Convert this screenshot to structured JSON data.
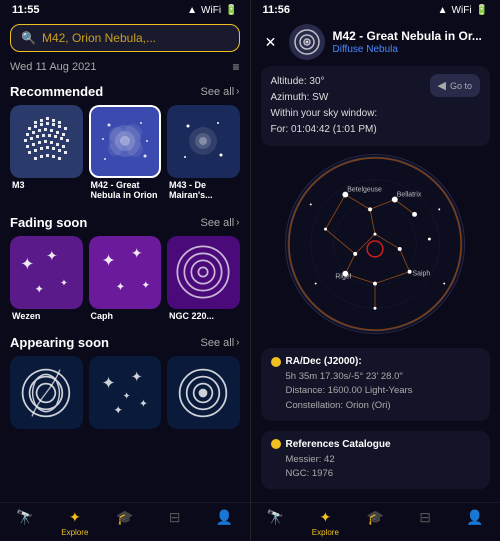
{
  "left": {
    "status": {
      "time": "11:55",
      "icons": "▲ ● ▓▓▓"
    },
    "search": {
      "placeholder": "M42, Orion Nebula,..."
    },
    "date": "Wed 11 Aug 2021",
    "filter_icon": "≡",
    "recommended": {
      "title": "Recommended",
      "see_all": "See all",
      "items": [
        {
          "name": "M3",
          "type": "cluster"
        },
        {
          "name": "M42 - Great Nebula in Orion",
          "type": "nebula",
          "selected": true
        },
        {
          "name": "M43 - De Mairan's...",
          "type": "nebula"
        }
      ]
    },
    "fading": {
      "title": "Fading soon",
      "see_all": "See all",
      "items": [
        {
          "name": "Wezen",
          "type": "star"
        },
        {
          "name": "Caph",
          "type": "star"
        },
        {
          "name": "NGC 220...",
          "type": "cluster"
        }
      ]
    },
    "appearing": {
      "title": "Appearing soon",
      "see_all": "See all",
      "items": [
        {
          "name": "",
          "type": "spiral"
        },
        {
          "name": "",
          "type": "stars"
        },
        {
          "name": "",
          "type": "spiral2"
        }
      ]
    },
    "nav": [
      {
        "label": "",
        "icon": "🔭",
        "active": false
      },
      {
        "label": "Explore",
        "icon": "☀",
        "active": true
      },
      {
        "label": "",
        "icon": "🎓",
        "active": false
      },
      {
        "label": "",
        "icon": "⊟",
        "active": false
      },
      {
        "label": "",
        "icon": "👤",
        "active": false
      }
    ]
  },
  "right": {
    "status": {
      "time": "11:56",
      "icons": "▲ ● ▓▓▓"
    },
    "object": {
      "title": "M42 - Great Nebula in Or...",
      "subtitle": "Diffuse Nebula"
    },
    "info": {
      "altitude": "Altitude: 30°",
      "azimuth": "Azimuth: SW",
      "window_label": "Within your sky window:",
      "window_time": "For: 01:04:42 (1:01 PM)",
      "goto_label": "Go to"
    },
    "coordinates": {
      "dot_color": "#f0c020",
      "header": "RA/Dec (J2000):",
      "ra": "5h 35m 17.30s/-5° 23' 28.0\"",
      "distance": "Distance: 1600.00 Light-Years",
      "constellation": "Constellation: Orion (Ori)"
    },
    "references": {
      "dot_color": "#f0c020",
      "header": "References Catalogue",
      "messier": "Messier: 42",
      "ngc": "NGC: 1976"
    },
    "nav": [
      {
        "label": "",
        "icon": "🔭",
        "active": false
      },
      {
        "label": "Explore",
        "icon": "☀",
        "active": true
      },
      {
        "label": "",
        "icon": "🎓",
        "active": false
      },
      {
        "label": "",
        "icon": "⊟",
        "active": false
      },
      {
        "label": "",
        "icon": "👤",
        "active": false
      }
    ]
  }
}
